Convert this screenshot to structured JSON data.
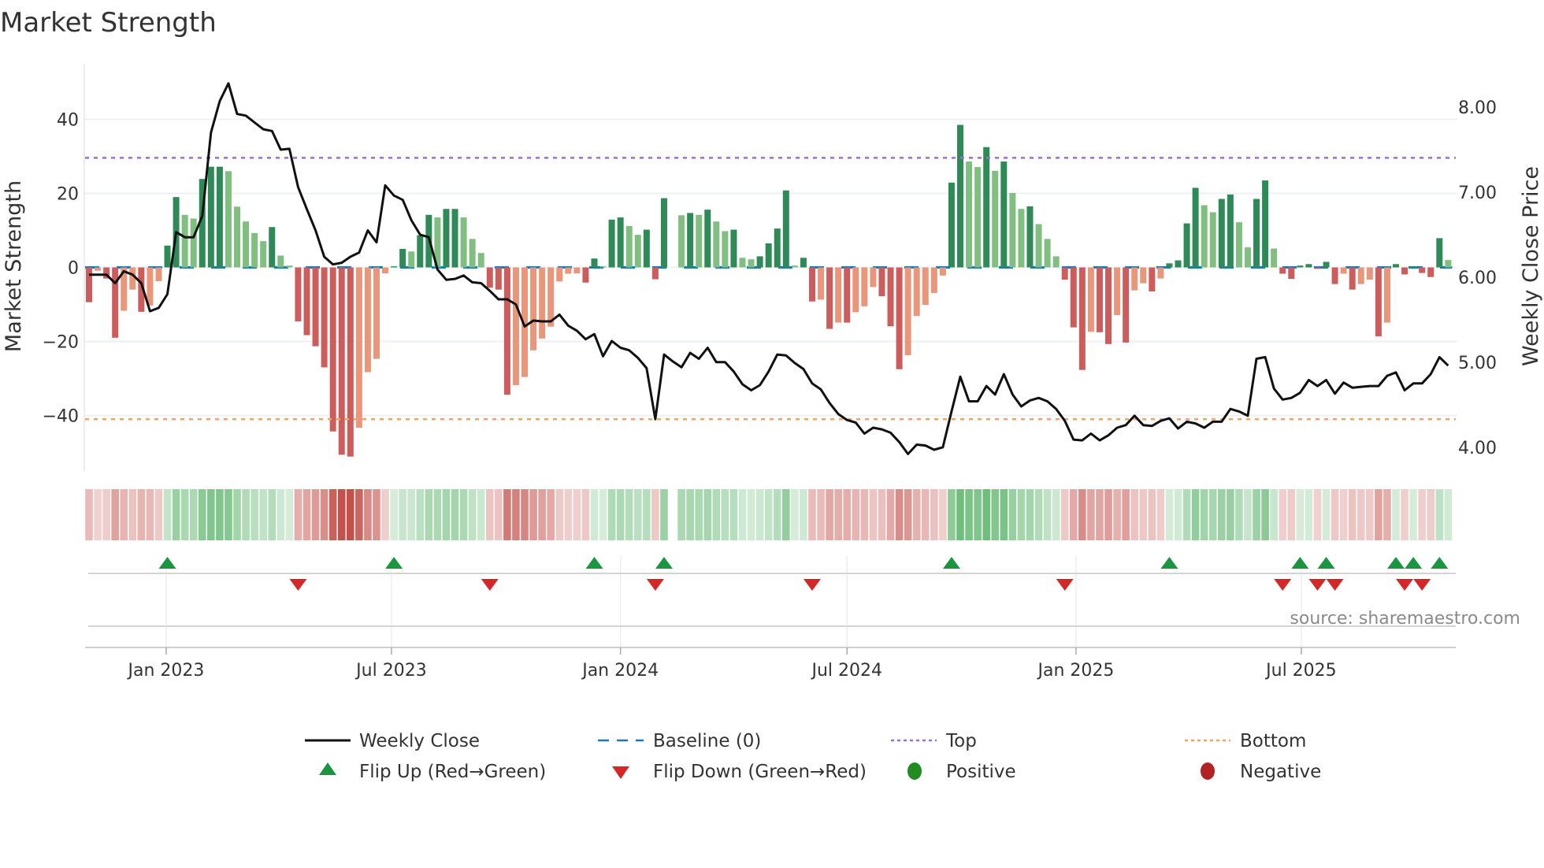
{
  "title": "Market Strength",
  "source_note": "source: sharemaestro.com",
  "legend": {
    "weekly_close": "Weekly Close",
    "baseline": "Baseline (0)",
    "top": "Top",
    "bottom": "Bottom",
    "flip_up": "Flip Up (Red→Green)",
    "flip_down": "Flip Down (Green→Red)",
    "positive": "Positive",
    "negative": "Negative"
  },
  "colors": {
    "strong_green": "#2e8b57",
    "weak_green": "#80bf80",
    "strong_red": "#cd5c5c",
    "weak_red": "#e9967a",
    "price_line": "#111111",
    "baseline": "#1f77b4",
    "top": "#9370db",
    "bottom": "#f4a460",
    "flip_up": "#1a9641",
    "flip_down": "#d62728",
    "positive": "#228b22",
    "negative": "#b22222"
  },
  "chart_data": {
    "type": "bar+line",
    "title": "Market Strength",
    "ylabel": "Market Strength",
    "y2label": "Weekly Close Price",
    "ylim": [
      -55,
      55
    ],
    "y2lim": [
      3.72,
      8.51
    ],
    "yticks": [
      40,
      20,
      0,
      -20,
      -40
    ],
    "ytick_labels": [
      "40",
      "20",
      "0",
      "−20",
      "−40"
    ],
    "y2ticks": [
      8,
      7,
      6,
      5,
      4
    ],
    "y2tick_labels": [
      "8.00",
      "7.00",
      "6.00",
      "5.00",
      "4.00"
    ],
    "xticks": [
      {
        "label": "Jan 2023",
        "date": "2023-01-01"
      },
      {
        "label": "Jul 2023",
        "date": "2023-07-01"
      },
      {
        "label": "Jan 2024",
        "date": "2024-01-01"
      },
      {
        "label": "Jul 2024",
        "date": "2024-07-01"
      },
      {
        "label": "Jan 2025",
        "date": "2025-01-01"
      },
      {
        "label": "Jul 2025",
        "date": "2025-07-01"
      }
    ],
    "first_week": "2022-10-31",
    "frequency": "weekly",
    "top_level": 29.6,
    "bottom_level": -41,
    "baseline": 0,
    "strength": [
      -9.4,
      -0.9,
      -3,
      -19,
      -11.7,
      -6,
      -12,
      -10.3,
      -3.7,
      5.9,
      19,
      14.2,
      13.2,
      23.9,
      27.2,
      27.2,
      26,
      16.4,
      12.4,
      9.3,
      7.1,
      10.9,
      3.2,
      0.5,
      -14.6,
      -18.3,
      -21.3,
      -27,
      -44.3,
      -50.6,
      -51.1,
      -43.3,
      -28.3,
      -24.7,
      -1.6,
      0.3,
      5,
      4.3,
      8.7,
      14.2,
      13.5,
      15.8,
      15.8,
      13.5,
      7.7,
      3.9,
      -5.5,
      -6,
      -34.4,
      -31.8,
      -29.6,
      -22.4,
      -19.2,
      -16,
      -3.8,
      -1.7,
      -1.6,
      -4.1,
      2.4,
      0.3,
      12.9,
      13.5,
      11.2,
      8.8,
      10.2,
      -3.2,
      18.7,
      0,
      14.1,
      14.7,
      14.2,
      15.6,
      12.4,
      9.8,
      10.2,
      2.6,
      2.2,
      3,
      6.5,
      10.5,
      20.8,
      0.5,
      2.6,
      -9.2,
      -8.7,
      -16.6,
      -14.9,
      -14.9,
      -12.1,
      -10.5,
      -5.3,
      -7.8,
      -15.9,
      -27.5,
      -23.7,
      -13.1,
      -10.1,
      -6.9,
      -2.2,
      22.9,
      38.5,
      28.6,
      27.1,
      32.5,
      26.1,
      28.6,
      20.1,
      15.8,
      16.5,
      11.7,
      7.7,
      3,
      -3.3,
      -16.2,
      -27.7,
      -17.4,
      -17.5,
      -20.7,
      -12.9,
      -20.3,
      -6.2,
      -4.3,
      -6.5,
      -3,
      1.1,
      1.9,
      11.9,
      21.5,
      16.8,
      14.9,
      18.5,
      19.7,
      12.2,
      5.4,
      18.5,
      23.5,
      5.1,
      -1.7,
      -3.1,
      0.5,
      0.9,
      -0.4,
      1.5,
      -4.5,
      -1.7,
      -6,
      -4.5,
      -3.3,
      -18.6,
      -14.9,
      0.9,
      -1.9,
      0.3,
      -1.5,
      -2.6,
      7.9,
      2
    ],
    "strength_shade": "dlddlldlld dlldddllll ldlldddddd dllllddldd lddllldddl lllllllddl ddllddddld ldlldllddd dlddldldll ldddllllld dlldldlldl lldddlddld lldlddddll ddllddlddd ddddldlldl ddddddl",
    "weekly_close": [
      6.03,
      6.03,
      6.03,
      5.93,
      6.07,
      6.03,
      5.93,
      5.6,
      5.64,
      5.8,
      6.53,
      6.47,
      6.47,
      6.72,
      7.7,
      8.07,
      8.28,
      7.92,
      7.9,
      7.82,
      7.74,
      7.72,
      7.5,
      7.51,
      7.06,
      6.8,
      6.55,
      6.24,
      6.15,
      6.17,
      6.24,
      6.29,
      6.55,
      6.41,
      7.08,
      6.96,
      6.91,
      6.67,
      6.5,
      6.47,
      6.09,
      5.97,
      5.98,
      6.02,
      5.94,
      5.93,
      5.84,
      5.74,
      5.74,
      5.68,
      5.42,
      5.49,
      5.48,
      5.48,
      5.56,
      5.43,
      5.37,
      5.27,
      5.33,
      5.07,
      5.25,
      5.17,
      5.14,
      5.05,
      4.93,
      4.33,
      5.09,
      5.01,
      4.94,
      5.11,
      5.04,
      5.17,
      5.0,
      5.0,
      4.89,
      4.74,
      4.67,
      4.73,
      4.89,
      5.09,
      5.08,
      4.99,
      4.92,
      4.75,
      4.68,
      4.52,
      4.39,
      4.32,
      4.29,
      4.16,
      4.23,
      4.21,
      4.17,
      4.06,
      3.92,
      4.03,
      4.02,
      3.97,
      4.0,
      4.42,
      4.83,
      4.54,
      4.54,
      4.72,
      4.62,
      4.86,
      4.62,
      4.48,
      4.55,
      4.58,
      4.54,
      4.45,
      4.31,
      4.09,
      4.08,
      4.16,
      4.08,
      4.14,
      4.23,
      4.26,
      4.37,
      4.26,
      4.25,
      4.31,
      4.34,
      4.22,
      4.3,
      4.28,
      4.23,
      4.3,
      4.3,
      4.45,
      4.42,
      4.37,
      5.04,
      5.06,
      4.69,
      4.56,
      4.58,
      4.64,
      4.79,
      4.72,
      4.79,
      4.63,
      4.76,
      4.7,
      4.71,
      4.72,
      4.72,
      4.84,
      4.88,
      4.67,
      4.75,
      4.75,
      4.86,
      5.06,
      4.96
    ],
    "flip_up_weeks": [
      10,
      36,
      59,
      67,
      100,
      125,
      140,
      143,
      151,
      153,
      156
    ],
    "flip_down_weeks": [
      25,
      47,
      66,
      84,
      113,
      138,
      142,
      144,
      152,
      154
    ],
    "legend_position": "bottom",
    "grid": true
  }
}
